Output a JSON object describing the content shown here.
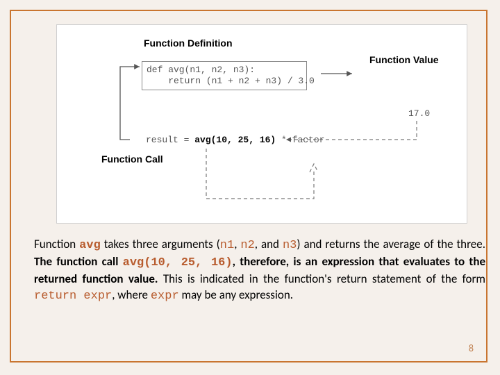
{
  "diagram": {
    "label_def": "Function Definition",
    "label_val": "Function Value",
    "label_call": "Function Call",
    "code_def_l1": "def avg(n1, n2, n3):",
    "code_def_l2": "    return (n1 + n2 + n3) / 3.0",
    "code_call_pre": "result = ",
    "code_call_bold": "avg(10, 25, 16)",
    "code_call_post": " * factor",
    "return_value": "17.0"
  },
  "paragraph": {
    "t1": "Function ",
    "m_avg": "avg",
    "t2": " takes three arguments (",
    "m_n1": "n1",
    "t3": ", ",
    "m_n2": "n2",
    "t4": ", and ",
    "m_n3": "n3",
    "t5": ") and returns the average of the three. ",
    "b1": "The function call ",
    "mb_call": "avg(10, 25, 16)",
    "b2": ", therefore, is an expression that evaluates to the returned function value.",
    "t6": " This is indicated in the function's return statement of the form ",
    "m_ret": "return expr",
    "t7": ", where ",
    "m_expr": "expr",
    "t8": " may be any expression."
  },
  "page_number": "8"
}
